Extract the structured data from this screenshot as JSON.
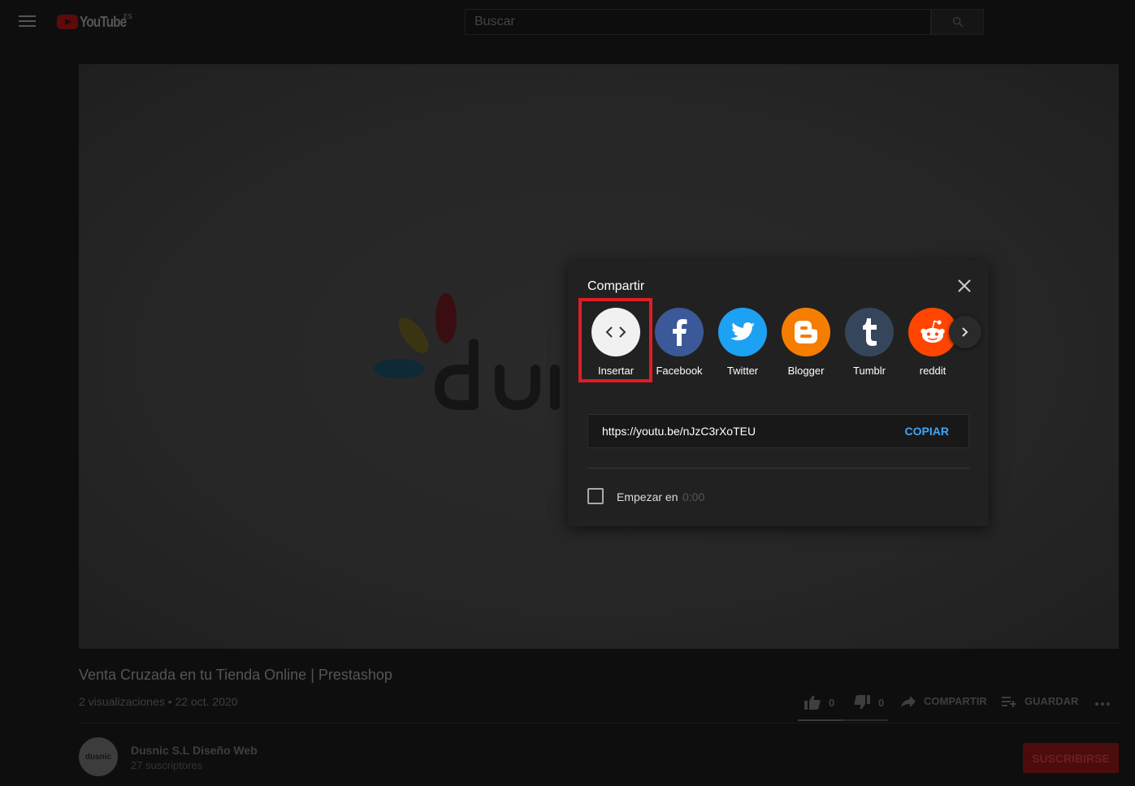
{
  "masthead": {
    "logo_text": "YouTube",
    "region": "ES",
    "search_placeholder": "Buscar"
  },
  "share_dialog": {
    "title": "Compartir",
    "targets": [
      {
        "label": "Insertar",
        "icon": "embed-icon",
        "color": "#f1f1f1"
      },
      {
        "label": "Facebook",
        "icon": "facebook-icon",
        "color": "#3b5998"
      },
      {
        "label": "Twitter",
        "icon": "twitter-icon",
        "color": "#1da1f2"
      },
      {
        "label": "Blogger",
        "icon": "blogger-icon",
        "color": "#f57d00"
      },
      {
        "label": "Tumblr",
        "icon": "tumblr-icon",
        "color": "#35465c"
      },
      {
        "label": "reddit",
        "icon": "reddit-icon",
        "color": "#ff4500"
      }
    ],
    "url": "https://youtu.be/nJzC3rXoTEU",
    "copy_label": "COPIAR",
    "start_label": "Empezar en",
    "start_time": "0:00",
    "highlight_color": "#e01d25"
  },
  "video": {
    "title": "Venta Cruzada en tu Tienda Online | Prestashop",
    "meta": "2 visualizaciones • 22 oct. 2020",
    "likes": "0",
    "dislikes": "0",
    "share_label": "COMPARTIR",
    "save_label": "GUARDAR"
  },
  "channel": {
    "name": "Dusnic S.L Diseño Web",
    "subscribers": "27 suscriptores",
    "avatar_text": "dusnic",
    "subscribe_label": "SUSCRIBIRSE"
  }
}
